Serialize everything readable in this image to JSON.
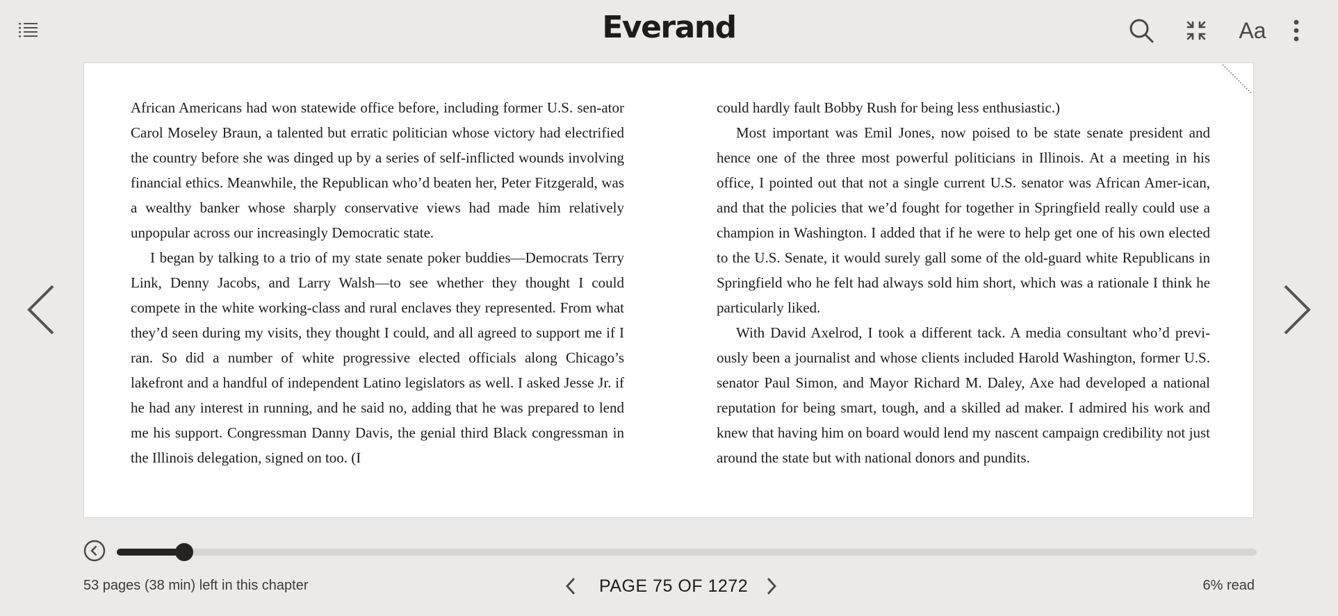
{
  "header": {
    "logo": "Everand",
    "icons": [
      "list-icon",
      "search-icon",
      "fullscreen-icon",
      "font-settings-icon",
      "more-vertical-icon"
    ],
    "font_button_label": "Aa"
  },
  "book": {
    "left_page": [
      "African Americans had won statewide office before, including former U.S. sen-ator Carol Moseley Braun, a talented but erratic politician whose victory had electrified the country before she was dinged up by a series of self-inflicted wounds involving financial ethics. Meanwhile, the Republican who’d beaten her, Peter Fitzgerald, was a wealthy banker whose sharply conservative views had made him relatively unpopular across our increasingly Democratic state.",
      "I began by talking to a trio of my state senate poker buddies—Democrats Terry Link, Denny Jacobs, and Larry Walsh—to see whether they thought I could compete in the white working-class and rural enclaves they represented. From what they’d seen during my visits, they thought I could, and all agreed to support me if I ran. So did a number of white progressive elected officials along Chicago’s lakefront and a handful of independent Latino legislators as well. I asked Jesse Jr. if he had any interest in running, and he said no, adding that he was prepared to lend me his support. Congressman Danny Davis, the genial third Black congressman in the Illinois delegation, signed on too. (I"
    ],
    "right_page": [
      "could hardly fault Bobby Rush for being less enthusiastic.)",
      "Most important was Emil Jones, now poised to be state senate president and hence one of the three most powerful politicians in Illinois. At a meeting in his office, I pointed out that not a single current U.S. senator was African Amer-ican, and that the policies that we’d fought for together in Springfield really could use a champion in Washington. I added that if he were to help get one of his own elected to the U.S. Senate, it would surely gall some of the old-guard white Republicans in Springfield who he felt had always sold him short, which was a rationale I think he particularly liked.",
      "With David Axelrod, I took a different tack. A media consultant who’d previ-ously been a journalist and whose clients included Harold Washington, former U.S. senator Paul Simon, and Mayor Richard M. Daley, Axe had developed a national reputation for being smart, tough, and a skilled ad maker. I admired his work and knew that having him on board would lend my nascent campaign credibility not just around the state but with national donors and pundits."
    ]
  },
  "footer": {
    "chapter_remaining": "53 pages (38 min) left in this chapter",
    "page_indicator": "PAGE 75 OF 1272",
    "percent_read": "6% read",
    "progress_fraction": 0.059
  },
  "colors": {
    "background": "#ebeae8",
    "page": "#ffffff",
    "accent": "#262320",
    "track": "#d6d5d2"
  }
}
